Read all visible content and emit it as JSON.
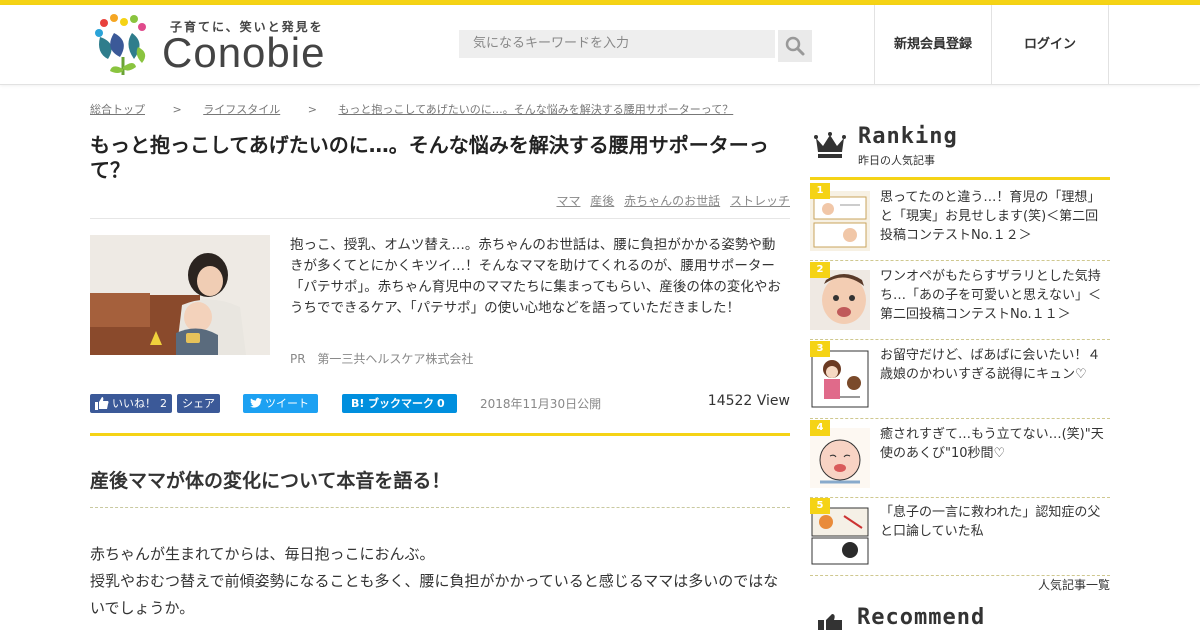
{
  "header": {
    "logo_tagline": "子育てに、笑いと発見を",
    "logo_text": "Conobie",
    "search_placeholder": "気になるキーワードを入力",
    "register": "新規会員登録",
    "login": "ログイン"
  },
  "breadcrumb": [
    "総合トップ",
    "ライフスタイル",
    "もっと抱っこしてあげたいのに…。そんな悩みを解決する腰用サポーターって？"
  ],
  "breadcrumb_sep": ">",
  "article": {
    "title": "もっと抱っこしてあげたいのに…。そんな悩みを解決する腰用サポーターって？",
    "tags": [
      "ママ",
      "産後",
      "赤ちゃんのお世話",
      "ストレッチ"
    ],
    "lead": "抱っこ、授乳、オムツ替え…。赤ちゃんのお世話は、腰に負担がかかる姿勢や動きが多くてとにかくキツイ…！そんなママを助けてくれるのが、腰用サポーター「パテサポ」。赤ちゃん育児中のママたちに集まってもらい、産後の体の変化やおうちでできるケア、「パテサポ」の使い心地などを語っていただきました！",
    "pr_label": "PR",
    "sponsor": "第一三共ヘルスケア株式会社",
    "like_label": "いいね！",
    "like_count": "2",
    "share_label": "シェア",
    "tweet_label": "ツイート",
    "bookmark_label": "ブックマーク",
    "bookmark_count": "0",
    "date": "2018年11月30日公開",
    "views": "14522 View",
    "heading": "産後ママが体の変化について本音を語る！",
    "paragraph_1": "赤ちゃんが生まれてからは、毎日抱っこにおんぶ。",
    "paragraph_2": "授乳やおむつ替えで前傾姿勢になることも多く、腰に負担がかかっていると感じるママは多いのではないでしょうか。"
  },
  "sidebar": {
    "ranking_title": "Ranking",
    "ranking_sub": "昨日の人気記事",
    "ranking": [
      {
        "num": "1",
        "text": "思ってたのと違う…！育児の「理想」と「現実」お見せします(笑)＜第二回投稿コンテストNo.１２＞"
      },
      {
        "num": "2",
        "text": "ワンオペがもたらすザラリとした気持ち…「あの子を可愛いと思えない」＜第二回投稿コンテストNo.１１＞"
      },
      {
        "num": "3",
        "text": "お留守だけど、ばあばに会いたい！４歳娘のかわいすぎる説得にキュン♡"
      },
      {
        "num": "4",
        "text": "癒されすぎて…もう立てない…(笑)\"天使のあくび\"10秒間♡"
      },
      {
        "num": "5",
        "text": "「息子の一言に救われた」認知症の父と口論していた私"
      }
    ],
    "ranking_all": "人気記事一覧",
    "recommend_title": "Recommend"
  },
  "colors": {
    "accent": "#f5d315",
    "facebook": "#3b5998",
    "twitter": "#1da1f2",
    "hatena": "#008fde"
  }
}
